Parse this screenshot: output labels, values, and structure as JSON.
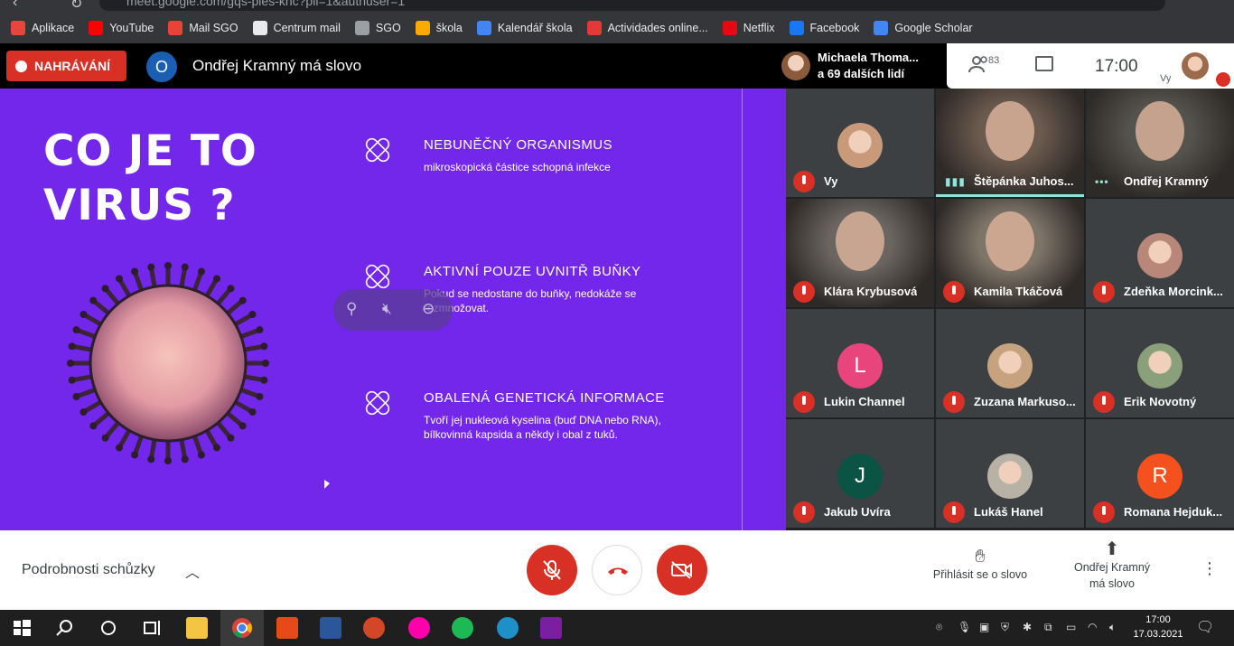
{
  "browser": {
    "url": "meet.google.com/gqs-pies-khc?pli=1&authuser=1",
    "bookmarks": [
      {
        "label": "Aplikace",
        "icon": "apps-grid-icon",
        "color": "#e8453c"
      },
      {
        "label": "YouTube",
        "icon": "youtube-icon",
        "color": "#ff0000"
      },
      {
        "label": "Mail SGO",
        "icon": "gmail-icon",
        "color": "#ea4335"
      },
      {
        "label": "Centrum mail",
        "icon": "envelope-icon",
        "color": "#e8eaed"
      },
      {
        "label": "SGO",
        "icon": "sgo-icon",
        "color": "#9aa0a6"
      },
      {
        "label": "škola",
        "icon": "classroom-icon",
        "color": "#f9ab00"
      },
      {
        "label": "Kalendář škola",
        "icon": "calendar-icon",
        "color": "#4285f4"
      },
      {
        "label": "Actividades online...",
        "icon": "activities-icon",
        "color": "#e53935"
      },
      {
        "label": "Netflix",
        "icon": "netflix-icon",
        "color": "#e50914"
      },
      {
        "label": "Facebook",
        "icon": "facebook-icon",
        "color": "#1877f2"
      },
      {
        "label": "Google Scholar",
        "icon": "scholar-icon",
        "color": "#4285f4"
      }
    ]
  },
  "header": {
    "recording_label": "NAHRÁVÁNÍ",
    "presenter_initial": "O",
    "presenter_title": "Ondřej Kramný má slovo",
    "participants_line1": "Michaela Thoma...",
    "participants_line2": "a 69 dalších lidí",
    "people_count": "83",
    "clock": "17:00",
    "self_label": "Vy"
  },
  "slide": {
    "title_line1": "CO JE TO",
    "title_line2": "VIRUS ?",
    "sections": [
      {
        "heading": "NEBUNĚČNÝ ORGANISMUS",
        "text": "mikroskopická částice schopná infekce"
      },
      {
        "heading": "AKTIVNÍ POUZE UVNITŘ BUŇKY",
        "text": "Pokud se nedostane do buňky, nedokáže se rozmnožovat."
      },
      {
        "heading": "OBALENÁ GENETICKÁ INFORMACE",
        "text": "Tvoří jej nukleová kyselina (buď DNA nebo RNA), bílkovinná kapsida a někdy i obal z tuků."
      }
    ]
  },
  "tiles": [
    {
      "name": "Vy",
      "initial": "",
      "avatar_color": "#c99a7a",
      "type": "avatar-photo"
    },
    {
      "name": "Štěpánka Juhos...",
      "initial": "",
      "avatar_color": "#6b5a4e",
      "type": "video",
      "speaking": true
    },
    {
      "name": "Ondřej Kramný",
      "initial": "",
      "avatar_color": "#55534e",
      "type": "video",
      "dots": true
    },
    {
      "name": "Klára Krybusová",
      "initial": "",
      "avatar_color": "#6a6560",
      "type": "video"
    },
    {
      "name": "Kamila Tkáčová",
      "initial": "",
      "avatar_color": "#7e7468",
      "type": "video"
    },
    {
      "name": "Zdeňka Morcink...",
      "initial": "",
      "avatar_color": "#b9867a",
      "type": "avatar-photo"
    },
    {
      "name": "Lukin Channel",
      "initial": "L",
      "avatar_color": "#e8457c",
      "type": "avatar"
    },
    {
      "name": "Zuzana Markuso...",
      "initial": "",
      "avatar_color": "#c7a27e",
      "type": "avatar-photo"
    },
    {
      "name": "Erik Novotný",
      "initial": "",
      "avatar_color": "#8aa07a",
      "type": "avatar-photo"
    },
    {
      "name": "Jakub Uvíra",
      "initial": "J",
      "avatar_color": "#0b5345",
      "type": "avatar"
    },
    {
      "name": "Lukáš Hanel",
      "initial": "",
      "avatar_color": "#b8b2a6",
      "type": "avatar-photo"
    },
    {
      "name": "Romana Hejduk...",
      "initial": "R",
      "avatar_color": "#f4511e",
      "type": "avatar"
    }
  ],
  "bottom": {
    "details_label": "Podrobnosti schůzky",
    "raise_hand_label": "Přihlásit se o slovo",
    "presenter_line1": "Ondřej Kramný",
    "presenter_line2": "má slovo"
  },
  "taskbar": {
    "time": "17:00",
    "date": "17.03.2021"
  },
  "colors": {
    "slide_bg": "#7327ea",
    "danger": "#d93025",
    "speaking": "#8ee3dd"
  }
}
